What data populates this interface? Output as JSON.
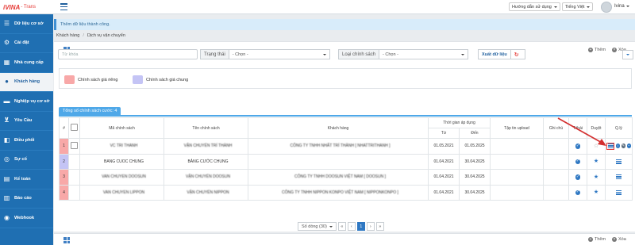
{
  "topbar": {
    "logo_brand": "iVINA",
    "logo_sub": "- Trans",
    "guide": "Hướng dẫn sử dụng",
    "language": "Tiếng Việt",
    "user": "Ivina"
  },
  "sidebar": {
    "items": [
      {
        "label": "Dữ liệu cơ sở",
        "icon": "list-icon"
      },
      {
        "label": "Cài đặt",
        "icon": "gear-icon"
      },
      {
        "label": "Nhà cung cấp",
        "icon": "store-icon"
      },
      {
        "label": "Khách hàng",
        "icon": "user-icon",
        "active": true
      },
      {
        "label": "Nghiệp vụ cơ sở",
        "icon": "truck-icon"
      },
      {
        "label": "Yêu Cầu",
        "icon": "cart-icon"
      },
      {
        "label": "Điều phối",
        "icon": "dispatch-icon"
      },
      {
        "label": "Sự cố",
        "icon": "warning-icon"
      },
      {
        "label": "Kế toán",
        "icon": "ledger-icon"
      },
      {
        "label": "Báo cáo",
        "icon": "report-icon"
      },
      {
        "label": "Webhook",
        "icon": "webhook-icon"
      }
    ]
  },
  "alert": "Thêm dữ liệu thành công.",
  "breadcrumb": [
    "Khách hàng",
    "Dịch vụ vận chuyển"
  ],
  "toolbar": {
    "add": "Thêm",
    "delete": "Xóa"
  },
  "filters": {
    "keyword_placeholder": "Từ khóa",
    "status_label": "Trạng thái",
    "status_value": "- Chọn -",
    "policy_label": "Loại chính sách",
    "policy_value": "- Chọn -",
    "export": "Xuất dữ liệu"
  },
  "legend": [
    {
      "label": "Chính sách giá riêng",
      "color": "#f8a8a8"
    },
    {
      "label": "Chính sách giá chung",
      "color": "#c4c4f5"
    }
  ],
  "total_tab": "Tổng số chính sách cước: 4",
  "table": {
    "headers": {
      "num": "#",
      "code": "Mã chính sách",
      "name": "Tên chính sách",
      "customer": "Khách hàng",
      "period": "Thời gian áp dụng",
      "from": "Từ",
      "to": "Đến",
      "upload": "Tập tin upload",
      "note": "Ghi chú",
      "status": "T.thái",
      "approve": "Duyệt",
      "manage": "Q.lý"
    },
    "rows": [
      {
        "num": "1",
        "type": "red",
        "code": "VC TRI THANH",
        "name": "VẬN CHUYỂN TRÍ THÀNH",
        "customer": "CÔNG TY TNHH NHẤT TRÍ THÀNH [ NHATTRITHANH ]",
        "from": "01.05.2021",
        "to": "01.05.2025",
        "approved": false,
        "blurred": true,
        "checkbox": true
      },
      {
        "num": "2",
        "type": "blue",
        "code": "BANG CUOC CHUNG",
        "name": "BẢNG CƯỚC CHUNG",
        "customer": "",
        "from": "01.04.2021",
        "to": "30.04.2025",
        "approved": true,
        "blurred": false,
        "checkbox": false
      },
      {
        "num": "3",
        "type": "red",
        "code": "VAN CHUYEN DOOSUN",
        "name": "VẬN CHUYỂN DOOSUN",
        "customer": "CÔNG TY TNHH DOOSUN VIỆT NAM [ DOOSUN ]",
        "from": "01.04.2021",
        "to": "30.04.2025",
        "approved": true,
        "blurred": true,
        "checkbox": false
      },
      {
        "num": "4",
        "type": "red",
        "code": "VAN CHUYEN LIPPON",
        "name": "VẬN CHUYỂN NIPPON",
        "customer": "CÔNG TY TNHH NIPPON KONPO VIỆT NAM [ NIPPONKONPO ]",
        "from": "01.04.2021",
        "to": "30.04.2025",
        "approved": true,
        "blurred": true,
        "checkbox": false
      }
    ]
  },
  "pager": {
    "rows_label": "Số dòng (30)",
    "first": "«",
    "prev": "‹",
    "page": "1",
    "next": "›",
    "last": "»"
  }
}
